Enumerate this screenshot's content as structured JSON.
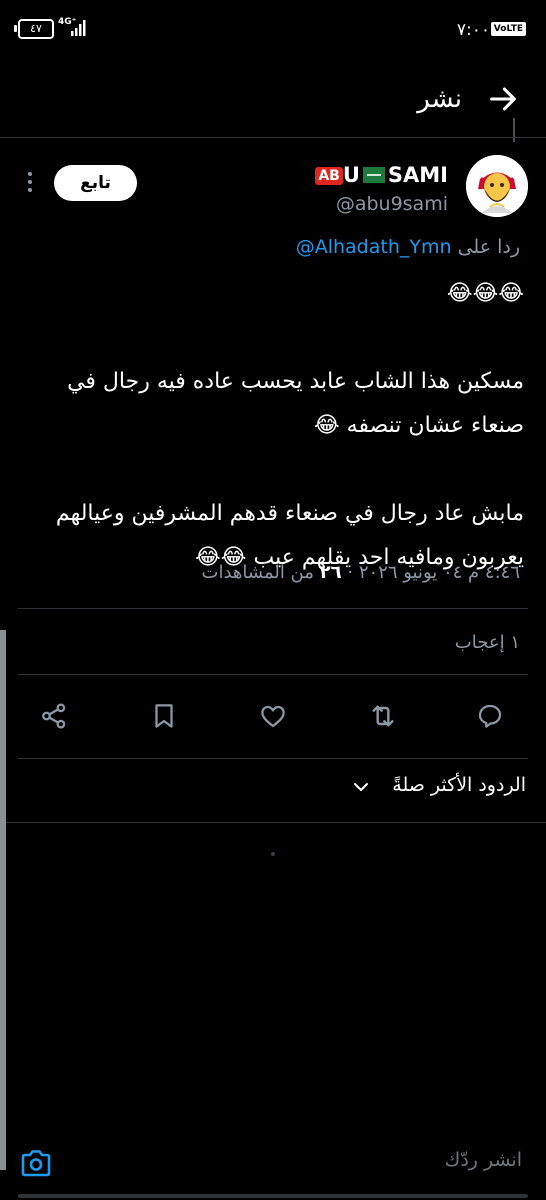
{
  "status_bar": {
    "time": "٧:٠٠",
    "volte": "VoLTE",
    "battery": "٤٧",
    "network": "4G⁺"
  },
  "header": {
    "title": "نشر",
    "back_icon": "arrow-right-icon"
  },
  "author": {
    "name_prefix": "AB",
    "name_middle": "U",
    "name_suffix": "SAMI",
    "handle": "@abu9sami",
    "follow_label": "تابع",
    "avatar_icon": "bearded-man-emoji-avatar"
  },
  "reply_to": {
    "prefix": "ردا على",
    "mention": "@Alhadath_Ymn"
  },
  "tweet": {
    "text": "😂😂😂\n\nمسكين هذا الشاب عابد يحسب عاده فيه رجال في صنعاء عشان تنصفه 😂\n\nمابش عاد رجال في صنعاء قدهم المشرفين وعيالهم يعربون ومافيه احد يقلهم عيب 😂😂"
  },
  "meta": {
    "time_date": "٤:٤٦ م ٠٤ يونيو ٢٠٢٦ ·",
    "views": "٢٦",
    "views_label": "من المشاهدات"
  },
  "likes": {
    "count": "١",
    "label": "إعجاب"
  },
  "actions": [
    "reply-icon",
    "retweet-icon",
    "like-icon",
    "bookmark-icon",
    "share-icon"
  ],
  "replies_sort": {
    "label": "الردود الأكثر صلةً"
  },
  "compose": {
    "placeholder": "انشر ردّك",
    "camera_icon": "camera-icon"
  },
  "colors": {
    "background": "#000000",
    "accent": "#1d9bf0",
    "muted": "#8b98a5",
    "separator": "#2f3336"
  }
}
